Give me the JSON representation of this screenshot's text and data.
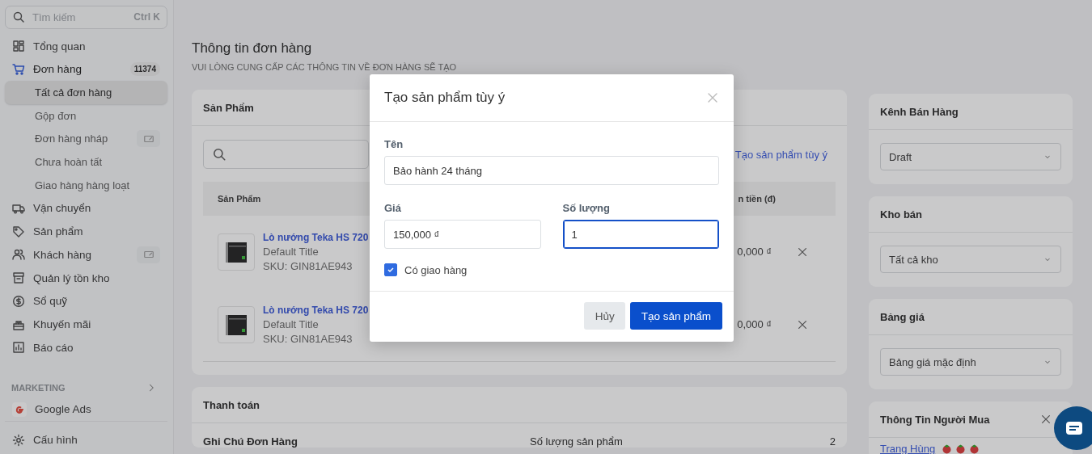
{
  "sidebar": {
    "search": {
      "placeholder": "Tìm kiếm",
      "shortcut": "Ctrl K"
    },
    "items": [
      {
        "label": "Tổng quan",
        "selected": false,
        "action_icon": false
      },
      {
        "label": "Đơn hàng",
        "selected": true,
        "badge": "11374",
        "action_icon": false,
        "children": [
          {
            "label": "Tất cả đơn hàng",
            "selected": true,
            "action_icon": false
          },
          {
            "label": "Gộp đơn",
            "selected": false,
            "action_icon": false
          },
          {
            "label": "Đơn hàng nháp",
            "selected": false,
            "action_icon": true
          },
          {
            "label": "Chưa hoàn tất",
            "selected": false,
            "action_icon": false
          },
          {
            "label": "Giao hàng hàng loạt",
            "selected": false,
            "action_icon": false
          }
        ]
      },
      {
        "label": "Vận chuyển",
        "selected": false,
        "action_icon": false
      },
      {
        "label": "Sản phẩm",
        "selected": false,
        "action_icon": false
      },
      {
        "label": "Khách hàng",
        "selected": false,
        "action_icon": true
      },
      {
        "label": "Quản lý tồn kho",
        "selected": false,
        "action_icon": false
      },
      {
        "label": "Sổ quỹ",
        "selected": false,
        "action_icon": false
      },
      {
        "label": "Khuyến mãi",
        "selected": false,
        "action_icon": false
      },
      {
        "label": "Báo cáo",
        "selected": false,
        "action_icon": false
      }
    ],
    "section": {
      "title": "MARKETING",
      "items": [
        {
          "label": "Google Ads",
          "selected": false
        }
      ]
    },
    "footer": {
      "label": "Cấu hình"
    }
  },
  "page": {
    "title": "Thông tin đơn hàng",
    "subtitle": "VUI LÒNG CUNG CẤP CÁC THÔNG TIN VỀ ĐƠN HÀNG SẼ TẠO"
  },
  "products": {
    "title": "Sản Phẩm",
    "link": "Tạo sản phẩm tùy ý",
    "columns": [
      "Sản Phẩm",
      "n tiền (đ)"
    ],
    "rows": [
      {
        "name": "Lò nướng Teka HS 720",
        "variant": "Default Title",
        "sku": "SKU: GIN81AE943",
        "total": "0,000 ₫"
      },
      {
        "name": "Lò nướng Teka HS 720",
        "variant": "Default Title",
        "sku": "SKU: GIN81AE943",
        "total": "0,000 ₫"
      }
    ]
  },
  "payment": {
    "title": "Thanh toán",
    "note_label": "Ghi Chú Đơn Hàng",
    "summary": [
      {
        "label": "Số lượng sản phẩm",
        "value": "2"
      }
    ]
  },
  "panels": [
    {
      "title": "Kênh Bán Hàng",
      "value": "Draft"
    },
    {
      "title": "Kho bán",
      "value": "Tất cả kho"
    },
    {
      "title": "Bảng giá",
      "value": "Bảng giá mặc định"
    }
  ],
  "buyer": {
    "title": "Thông Tin Người Mua",
    "name": "Trang Hùng"
  },
  "modal": {
    "title": "Tạo sản phẩm tùy ý",
    "name": {
      "label": "Tên",
      "value": "Bảo hành 24 tháng"
    },
    "price": {
      "label": "Giá",
      "value": "150,000 ₫",
      "focused": false
    },
    "quantity": {
      "label": "Số lượng",
      "value": "1",
      "focused": true
    },
    "shipping": {
      "label": "Có giao hàng",
      "checked": true
    },
    "cancel": "Hủy",
    "submit": "Tạo sản phẩm"
  }
}
